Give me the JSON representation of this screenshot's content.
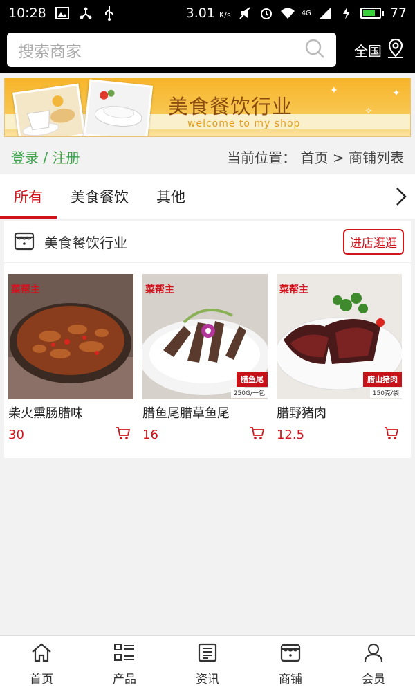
{
  "status_bar": {
    "time": "10:28",
    "net_speed": "3.01",
    "net_speed_unit": "K/s",
    "signal": "4G",
    "battery": "77",
    "battery_level": 0.77,
    "battery_color": "#3bd13b"
  },
  "header": {
    "search_placeholder": "搜索商家",
    "region": "全国"
  },
  "banner": {
    "title": "美食餐饮行业",
    "subtitle": "welcome to my shop"
  },
  "account": {
    "login": "登录",
    "separator": "/",
    "register": "注册"
  },
  "breadcrumb": {
    "prefix": "当前位置：",
    "home": "首页",
    "separator": ">",
    "current": "商铺列表"
  },
  "tabs": [
    {
      "label": "所有",
      "active": true
    },
    {
      "label": "美食餐饮",
      "active": false
    },
    {
      "label": "其他",
      "active": false
    }
  ],
  "store": {
    "name": "美食餐饮行业",
    "visit_label": "进店逛逛",
    "products": [
      {
        "name": "柴火熏肠腊味",
        "price": "30",
        "image_brand": "菜帮主"
      },
      {
        "name": "腊鱼尾腊草鱼尾",
        "price": "16",
        "image_brand": "菜帮主",
        "image_tag": "腊鱼尾",
        "image_tag_sub": "250G/一包"
      },
      {
        "name": "腊野猪肉",
        "price": "12.5",
        "image_brand": "菜帮主",
        "image_tag": "腊山猪肉",
        "image_tag_sub": "150克/袋"
      }
    ]
  },
  "bottom_nav": [
    {
      "label": "首页",
      "icon": "home-icon"
    },
    {
      "label": "产品",
      "icon": "list-icon"
    },
    {
      "label": "资讯",
      "icon": "news-icon"
    },
    {
      "label": "商铺",
      "icon": "store-icon"
    },
    {
      "label": "会员",
      "icon": "user-icon"
    }
  ],
  "colors": {
    "accent": "#d0141b",
    "login_green": "#3da24a",
    "header_bg": "#000000"
  }
}
